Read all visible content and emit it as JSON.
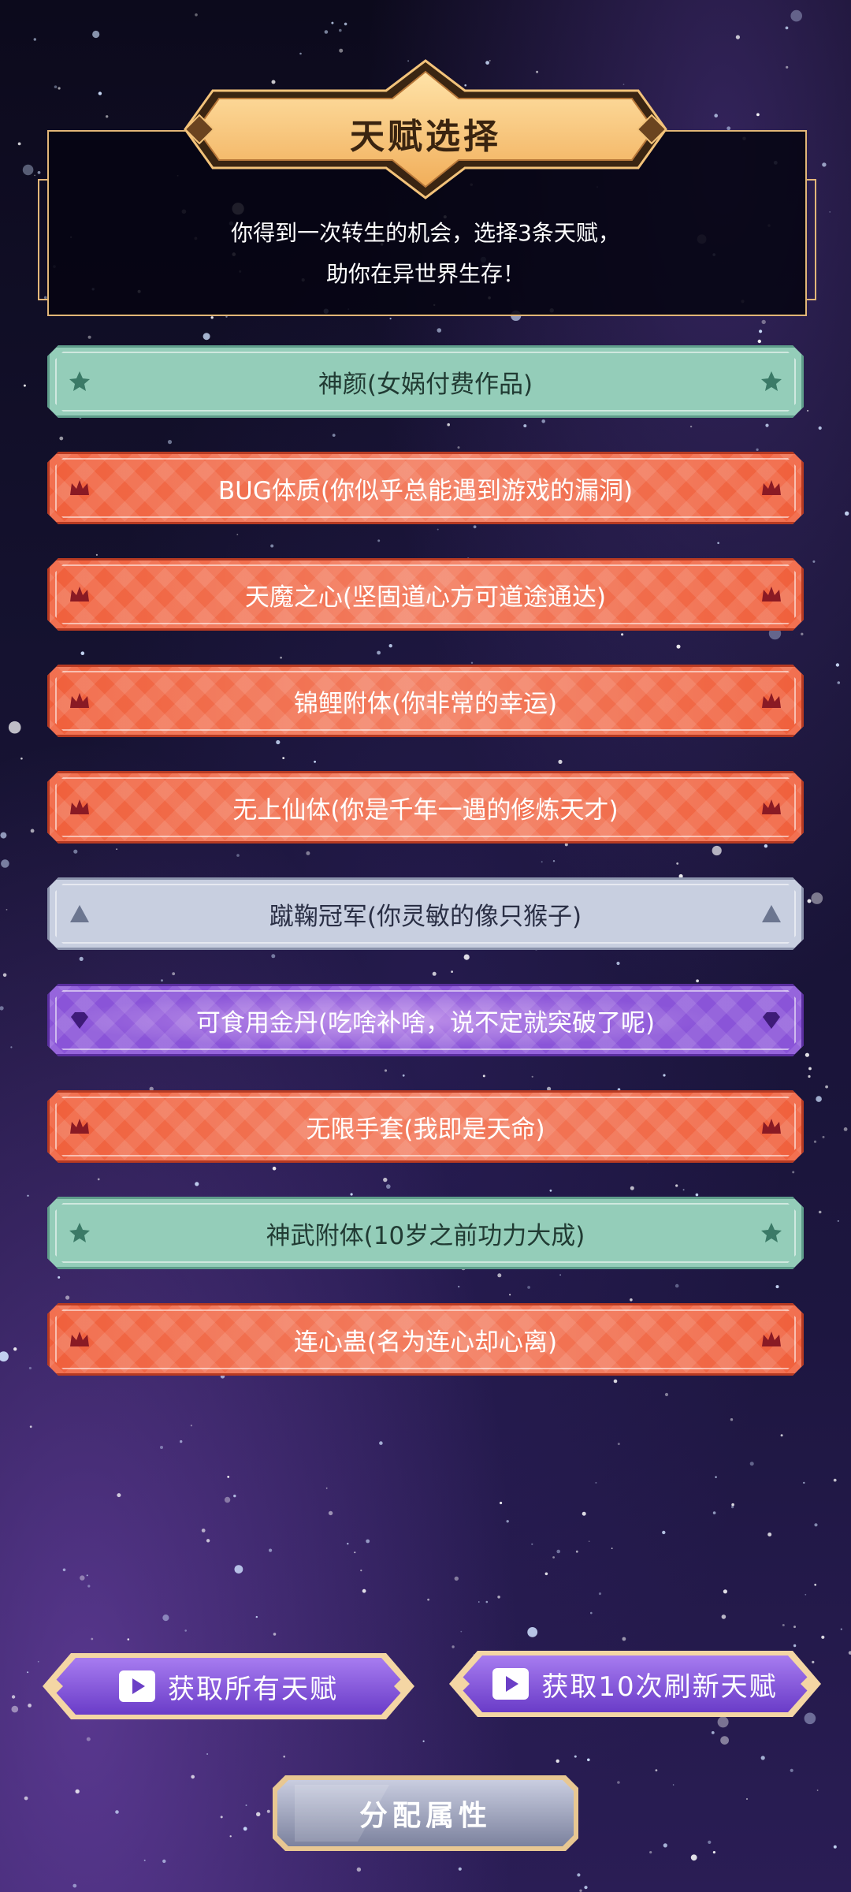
{
  "header": {
    "title": "天赋选择",
    "intro_line1": "你得到一次转生的机会，选择3条天赋，",
    "intro_line2": "助你在异世界生存！"
  },
  "talents": [
    {
      "label": "神颜(女娲付费作品)",
      "tier": "green",
      "icon": "star-icon"
    },
    {
      "label": "BUG体质(你似乎总能遇到游戏的漏洞)",
      "tier": "red",
      "icon": "crown-icon"
    },
    {
      "label": "天魔之心(坚固道心方可道途通达)",
      "tier": "red",
      "icon": "crown-icon"
    },
    {
      "label": "锦鲤附体(你非常的幸运)",
      "tier": "red",
      "icon": "crown-icon"
    },
    {
      "label": "无上仙体(你是千年一遇的修炼天才)",
      "tier": "red",
      "icon": "crown-icon"
    },
    {
      "label": "蹴鞠冠军(你灵敏的像只猴子)",
      "tier": "grey",
      "icon": "triangle-icon"
    },
    {
      "label": "可食用金丹(吃啥补啥，说不定就突破了呢)",
      "tier": "purple",
      "icon": "diamond-icon"
    },
    {
      "label": "无限手套(我即是天命)",
      "tier": "red",
      "icon": "crown-icon"
    },
    {
      "label": "神武附体(10岁之前功力大成)",
      "tier": "green",
      "icon": "star-icon"
    },
    {
      "label": "连心蛊(名为连心却心离)",
      "tier": "red",
      "icon": "crown-icon"
    }
  ],
  "buttons": {
    "get_all_talents": "获取所有天赋",
    "get_10_refresh": "获取10次刷新天赋",
    "assign_attributes": "分配属性"
  },
  "colors": {
    "green": "#94cdb9",
    "red": "#f0603c",
    "grey": "#c8cfe0",
    "purple": "#8a54d8",
    "gold": "#e2b679"
  }
}
